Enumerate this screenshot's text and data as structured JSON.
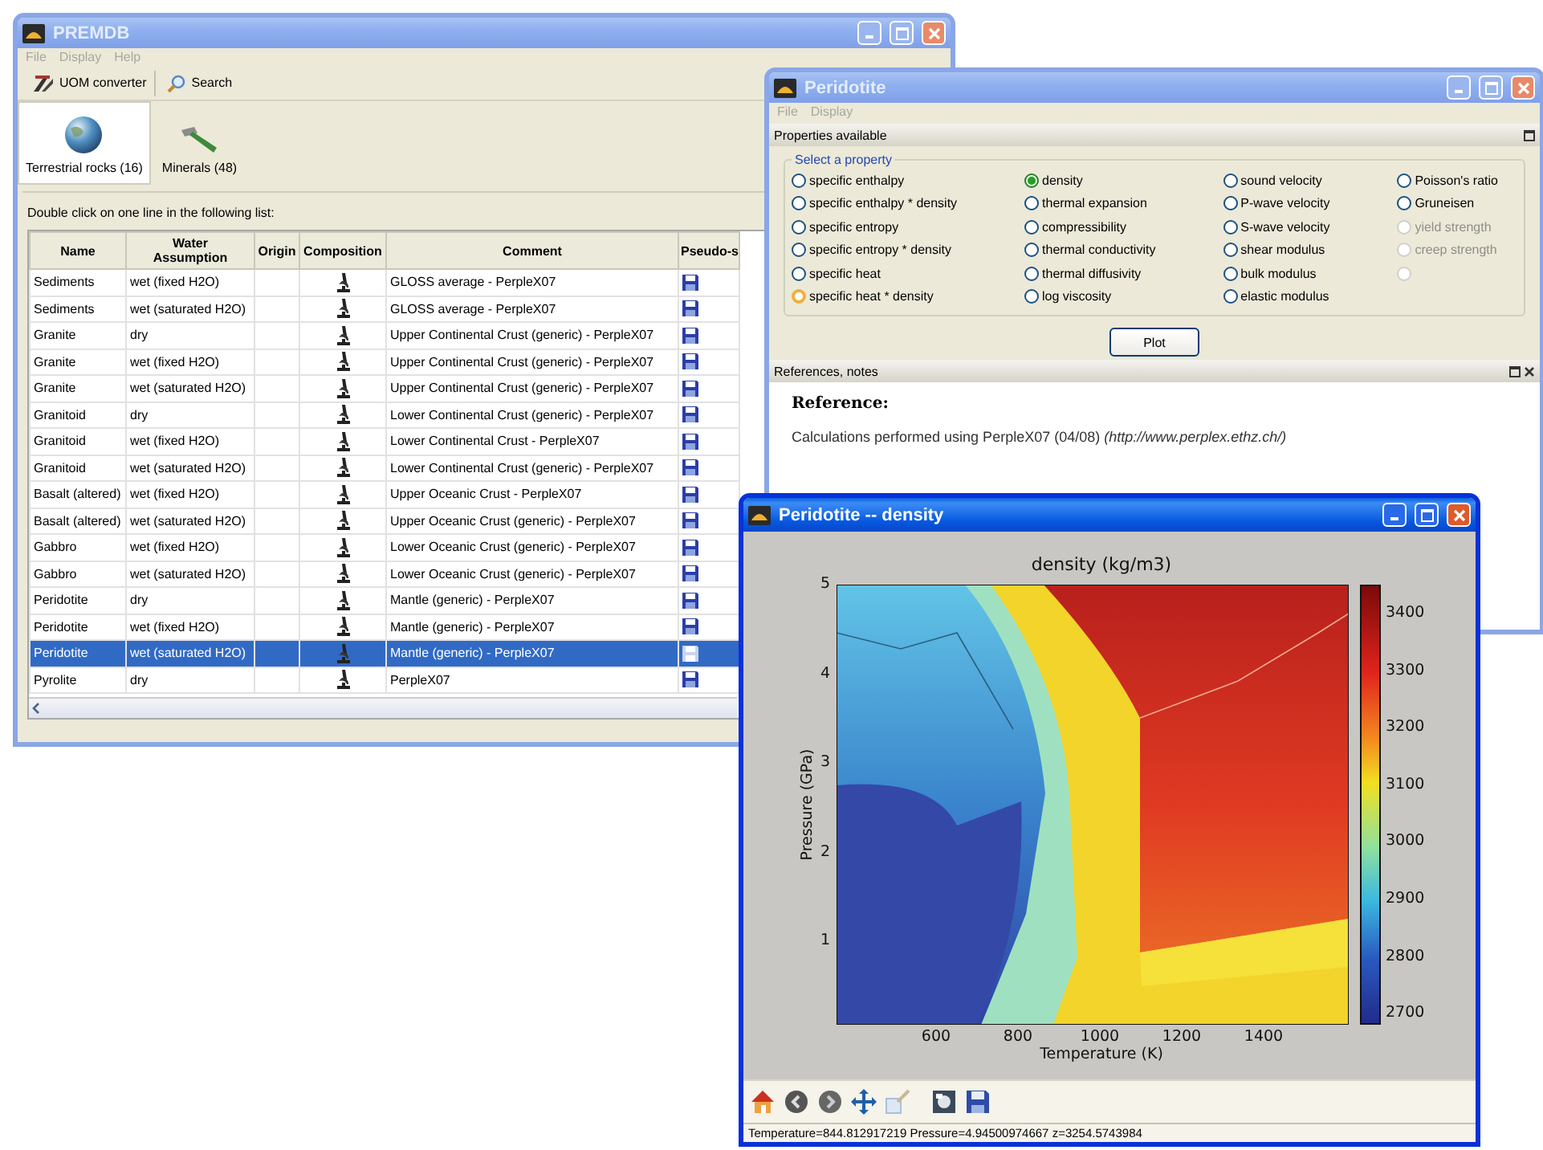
{
  "main_window": {
    "title": "PREMDB",
    "active": false,
    "menu": [
      "File",
      "Display",
      "Help"
    ],
    "toolbar": [
      {
        "label": "UOM converter",
        "kind": "converter"
      },
      {
        "label": "Search",
        "kind": "search"
      }
    ],
    "tabs": [
      {
        "label": "Terrestrial rocks (16)",
        "selected": true,
        "kind": "rocks"
      },
      {
        "label": "Minerals (48)",
        "selected": false,
        "kind": "minerals"
      }
    ],
    "instruction": "Double click on one line in the following list:",
    "table": {
      "columns": [
        "Name",
        "Water Assumption",
        "Origin",
        "Composition",
        "Comment",
        "Pseudo-s"
      ],
      "rows": [
        {
          "name": "Sediments",
          "water": "wet (fixed H2O)",
          "comment": "GLOSS average - PerpleX07",
          "selected": false
        },
        {
          "name": "Sediments",
          "water": "wet (saturated H2O)",
          "comment": "GLOSS average - PerpleX07",
          "selected": false
        },
        {
          "name": "Granite",
          "water": "dry",
          "comment": "Upper Continental Crust (generic) - PerpleX07",
          "selected": false
        },
        {
          "name": "Granite",
          "water": "wet (fixed H2O)",
          "comment": "Upper Continental Crust (generic) - PerpleX07",
          "selected": false
        },
        {
          "name": "Granite",
          "water": "wet (saturated H2O)",
          "comment": "Upper Continental Crust (generic) - PerpleX07",
          "selected": false
        },
        {
          "name": "Granitoid",
          "water": "dry",
          "comment": "Lower Continental Crust (generic) - PerpleX07",
          "selected": false
        },
        {
          "name": "Granitoid",
          "water": "wet (fixed H2O)",
          "comment": "Lower Continental Crust - PerpleX07",
          "selected": false
        },
        {
          "name": "Granitoid",
          "water": "wet (saturated H2O)",
          "comment": "Lower Continental Crust (generic) - PerpleX07",
          "selected": false
        },
        {
          "name": "Basalt (altered)",
          "water": "wet (fixed H2O)",
          "comment": "Upper Oceanic Crust - PerpleX07",
          "selected": false
        },
        {
          "name": "Basalt (altered)",
          "water": "wet (saturated H2O)",
          "comment": "Upper Oceanic Crust (generic) - PerpleX07",
          "selected": false
        },
        {
          "name": "Gabbro",
          "water": "wet (fixed H2O)",
          "comment": "Lower Oceanic Crust (generic) - PerpleX07",
          "selected": false
        },
        {
          "name": "Gabbro",
          "water": "wet (saturated H2O)",
          "comment": "Lower Oceanic Crust (generic) - PerpleX07",
          "selected": false
        },
        {
          "name": "Peridotite",
          "water": "dry",
          "comment": "Mantle (generic) - PerpleX07",
          "selected": false
        },
        {
          "name": "Peridotite",
          "water": "wet (fixed H2O)",
          "comment": "Mantle (generic) - PerpleX07",
          "selected": false
        },
        {
          "name": "Peridotite",
          "water": "wet (saturated H2O)",
          "comment": "Mantle (generic) - PerpleX07",
          "selected": true
        },
        {
          "name": "Pyrolite",
          "water": "dry",
          "comment": "PerpleX07",
          "selected": false
        }
      ]
    }
  },
  "property_window": {
    "title": "Peridotite",
    "active": false,
    "menu": [
      "File",
      "Display"
    ],
    "properties_panel": {
      "title": "Properties available",
      "group_label": "Select a property",
      "button": "Plot",
      "columns": [
        {
          "options": [
            {
              "label": "specific enthalpy",
              "selected": false,
              "disabled": false,
              "hovered": false
            },
            {
              "label": "specific enthalpy * density",
              "selected": false,
              "disabled": false,
              "hovered": false
            },
            {
              "label": "specific entropy",
              "selected": false,
              "disabled": false,
              "hovered": false
            },
            {
              "label": "specific entropy * density",
              "selected": false,
              "disabled": false,
              "hovered": false
            },
            {
              "label": "specific heat",
              "selected": false,
              "disabled": false,
              "hovered": false
            },
            {
              "label": "specific heat * density",
              "selected": false,
              "disabled": false,
              "hovered": true
            }
          ]
        },
        {
          "options": [
            {
              "label": "density",
              "selected": true,
              "disabled": false,
              "hovered": false
            },
            {
              "label": "thermal expansion",
              "selected": false,
              "disabled": false,
              "hovered": false
            },
            {
              "label": "compressibility",
              "selected": false,
              "disabled": false,
              "hovered": false
            },
            {
              "label": "thermal conductivity",
              "selected": false,
              "disabled": false,
              "hovered": false
            },
            {
              "label": "thermal diffusivity",
              "selected": false,
              "disabled": false,
              "hovered": false
            },
            {
              "label": "log viscosity",
              "selected": false,
              "disabled": false,
              "hovered": false
            }
          ]
        },
        {
          "options": [
            {
              "label": "sound velocity",
              "selected": false,
              "disabled": false,
              "hovered": false
            },
            {
              "label": "P-wave velocity",
              "selected": false,
              "disabled": false,
              "hovered": false
            },
            {
              "label": "S-wave velocity",
              "selected": false,
              "disabled": false,
              "hovered": false
            },
            {
              "label": "shear modulus",
              "selected": false,
              "disabled": false,
              "hovered": false
            },
            {
              "label": "bulk modulus",
              "selected": false,
              "disabled": false,
              "hovered": false
            },
            {
              "label": "elastic modulus",
              "selected": false,
              "disabled": false,
              "hovered": false
            }
          ]
        },
        {
          "options": [
            {
              "label": "Poisson's ratio",
              "selected": false,
              "disabled": false,
              "hovered": false
            },
            {
              "label": "Gruneisen",
              "selected": false,
              "disabled": false,
              "hovered": false
            },
            {
              "label": "yield strength",
              "selected": false,
              "disabled": true,
              "hovered": false
            },
            {
              "label": "creep strength",
              "selected": false,
              "disabled": true,
              "hovered": false
            },
            {
              "selected": false,
              "disabled": true,
              "hovered": false
            }
          ]
        }
      ]
    },
    "references_panel": {
      "title": "References, notes",
      "heading": "Reference:",
      "text": "Calculations performed using PerpleX07 (04/08) *(http://www.perplex.ethz.ch/)*"
    }
  },
  "plot_window": {
    "title": "Peridotite -- density",
    "active": true,
    "plot": {
      "title": "density (kg/m3)",
      "xlabel": "Temperature (K)",
      "ylabel": "Pressure (GPa)",
      "xticks": [
        "600",
        "800",
        "1000",
        "1200",
        "1400"
      ],
      "yticks": [
        "5",
        "4",
        "3",
        "2",
        "1"
      ],
      "colorbar_ticks": [
        "3400",
        "3300",
        "3200",
        "3100",
        "3000",
        "2900",
        "2800",
        "2700"
      ]
    },
    "status": "Temperature=844.812917219 Pressure=4.94500974667 z=3254.5743984"
  }
}
